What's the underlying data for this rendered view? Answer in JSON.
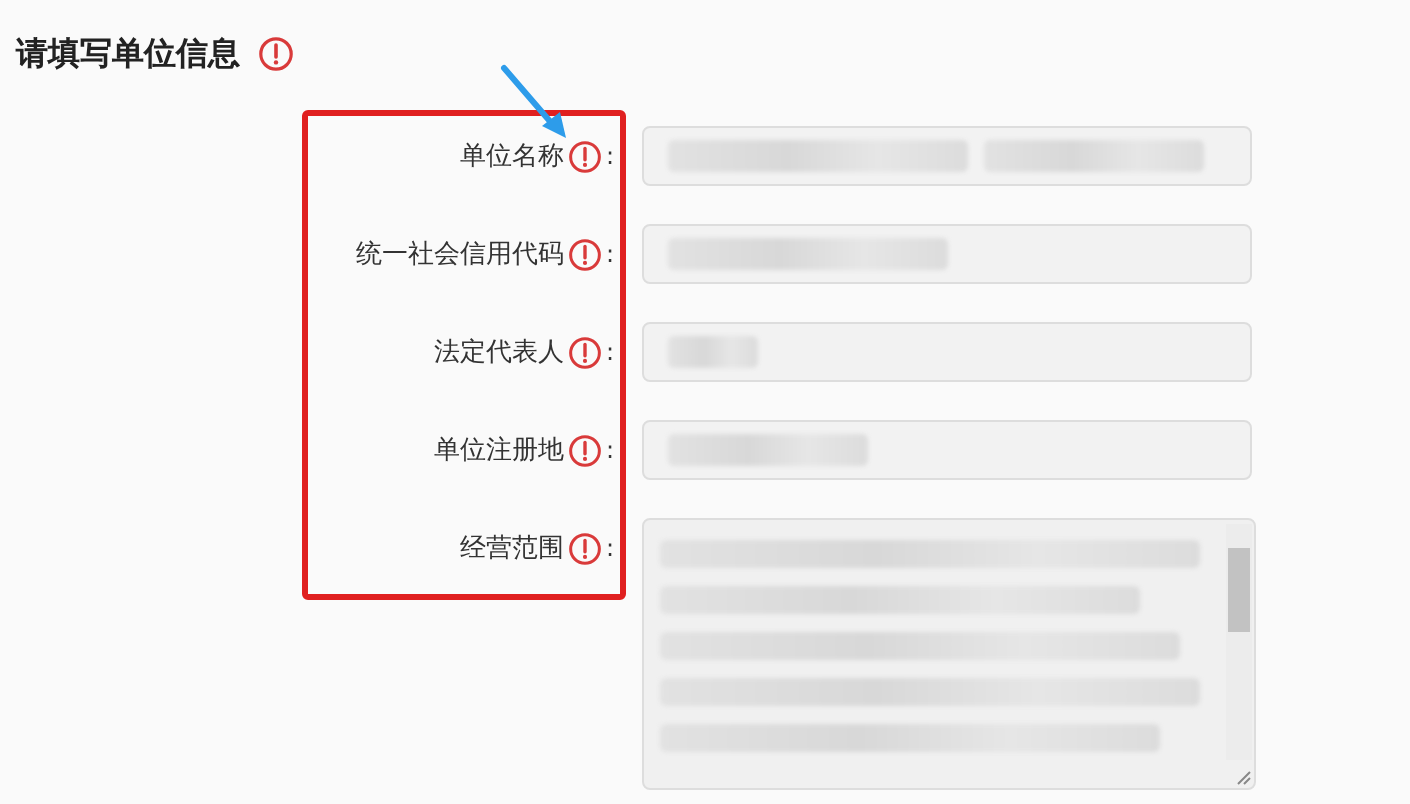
{
  "title": "请填写单位信息",
  "fields": [
    {
      "label": "单位名称",
      "colon": ":",
      "kind": "input"
    },
    {
      "label": "统一社会信用代码",
      "colon": ":",
      "kind": "input"
    },
    {
      "label": "法定代表人",
      "colon": ":",
      "kind": "input"
    },
    {
      "label": "单位注册地",
      "colon": ":",
      "kind": "input"
    },
    {
      "label": "经营范围",
      "colon": ":",
      "kind": "textarea"
    }
  ]
}
